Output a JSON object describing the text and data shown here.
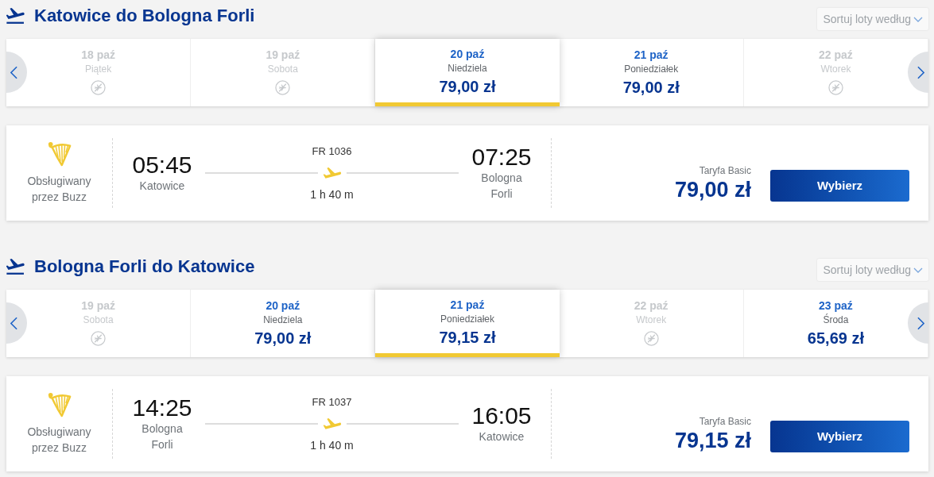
{
  "sections": [
    {
      "title": "Katowice do Bologna Forli",
      "sort_dropdown": {
        "label": "Sortuj loty według"
      },
      "dates": [
        {
          "date": "18 paź",
          "weekday": "Piątek",
          "available": false,
          "selected": false
        },
        {
          "date": "19 paź",
          "weekday": "Sobota",
          "available": false,
          "selected": false
        },
        {
          "date": "20 paź",
          "weekday": "Niedziela",
          "price": "79,00 zł",
          "available": true,
          "selected": true
        },
        {
          "date": "21 paź",
          "weekday": "Poniedziałek",
          "price": "79,00 zł",
          "available": true,
          "selected": false
        },
        {
          "date": "22 paź",
          "weekday": "Wtorek",
          "available": false,
          "selected": false
        }
      ],
      "flight": {
        "operator": "Obsługiwany przez Buzz",
        "departure": {
          "time": "05:45",
          "city": "Katowice"
        },
        "flight_number": "FR 1036",
        "duration": "1 h 40 m",
        "arrival": {
          "time": "07:25",
          "city": "Bologna Forli"
        },
        "fare_name": "Taryfa Basic",
        "price": "79,00 zł",
        "button": "Wybierz"
      }
    },
    {
      "title": "Bologna Forli do Katowice",
      "sort_dropdown": {
        "label": "Sortuj loty według"
      },
      "dates": [
        {
          "date": "19 paź",
          "weekday": "Sobota",
          "available": false,
          "selected": false
        },
        {
          "date": "20 paź",
          "weekday": "Niedziela",
          "price": "79,00 zł",
          "available": true,
          "selected": false
        },
        {
          "date": "21 paź",
          "weekday": "Poniedziałek",
          "price": "79,15 zł",
          "available": true,
          "selected": true
        },
        {
          "date": "22 paź",
          "weekday": "Wtorek",
          "available": false,
          "selected": false
        },
        {
          "date": "23 paź",
          "weekday": "Środa",
          "price": "65,69 zł",
          "available": true,
          "selected": false
        }
      ],
      "flight": {
        "operator": "Obsługiwany przez Buzz",
        "departure": {
          "time": "14:25",
          "city": "Bologna Forli"
        },
        "flight_number": "FR 1037",
        "duration": "1 h 40 m",
        "arrival": {
          "time": "16:05",
          "city": "Katowice"
        },
        "fare_name": "Taryfa Basic",
        "price": "79,15 zł",
        "button": "Wybierz"
      }
    }
  ]
}
